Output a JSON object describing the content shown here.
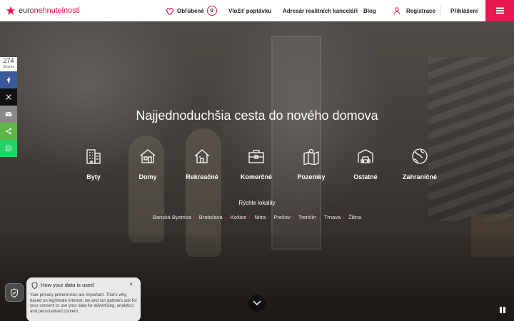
{
  "header": {
    "logo_prefix": "euro",
    "logo_accent": "nehnutelnosti",
    "nav": {
      "favorites_label": "Obľúbené",
      "favorites_count": "0",
      "request_label": "Vložiť poptávku",
      "agencies_label": "Adresár realitních kanceláří",
      "blog_label": "Blog",
      "register_label": "Registrace",
      "login_label": "Přihlášení"
    },
    "menu_icon": "hamburger-icon",
    "brand_color": "#e8174f"
  },
  "share": {
    "count": "274",
    "count_label": "Shares",
    "buttons": [
      "facebook-icon",
      "x-icon",
      "email-icon",
      "share-icon",
      "whatsapp-icon"
    ]
  },
  "hero": {
    "headline": "Najjednoduchšia cesta do nového domova",
    "categories": [
      {
        "label": "Byty",
        "icon": "apartment-building-icon"
      },
      {
        "label": "Domy",
        "icon": "house-icon"
      },
      {
        "label": "Rekreačné",
        "icon": "cottage-icon"
      },
      {
        "label": "Komerčné",
        "icon": "briefcase-icon"
      },
      {
        "label": "Pozemky",
        "icon": "land-map-icon"
      },
      {
        "label": "Ostatné",
        "icon": "garage-car-icon"
      },
      {
        "label": "Zahraničné",
        "icon": "globe-icon"
      }
    ],
    "quick_title": "Rýchle lokality",
    "quick_locations": [
      "Banská Bystrica",
      "Bratislava",
      "Košice",
      "Nitra",
      "Prešov",
      "Trenčín",
      "Trnava",
      "Žilina"
    ]
  },
  "cookie": {
    "title": "How your data is used",
    "body": "Your privacy preferences are important. That's why, based on legitimate interest, we and our partners ask for your consent to use your data for advertising, analytics and personalised content."
  }
}
